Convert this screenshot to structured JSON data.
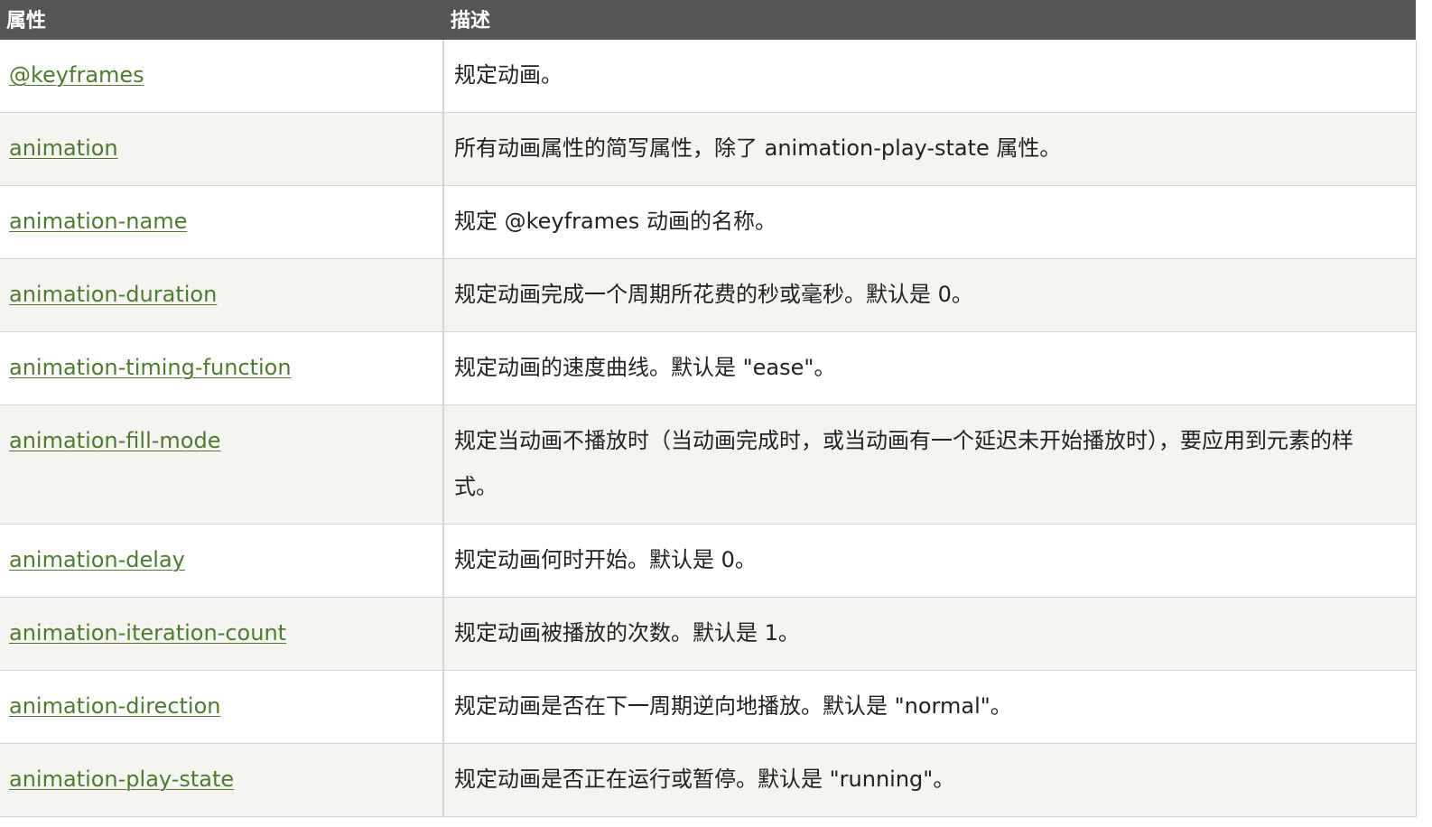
{
  "header": {
    "property": "属性",
    "description": "描述"
  },
  "rows": [
    {
      "property": "@keyframes",
      "description": "规定动画。"
    },
    {
      "property": "animation",
      "description": "所有动画属性的简写属性，除了 animation-play-state 属性。"
    },
    {
      "property": "animation-name",
      "description": "规定 @keyframes 动画的名称。"
    },
    {
      "property": "animation-duration",
      "description": "规定动画完成一个周期所花费的秒或毫秒。默认是 0。"
    },
    {
      "property": "animation-timing-function",
      "description": "规定动画的速度曲线。默认是 \"ease\"。"
    },
    {
      "property": "animation-fill-mode",
      "description": "规定当动画不播放时（当动画完成时，或当动画有一个延迟未开始播放时），要应用到元素的样式。"
    },
    {
      "property": "animation-delay",
      "description": "规定动画何时开始。默认是 0。"
    },
    {
      "property": "animation-iteration-count",
      "description": "规定动画被播放的次数。默认是 1。"
    },
    {
      "property": "animation-direction",
      "description": "规定动画是否在下一周期逆向地播放。默认是 \"normal\"。"
    },
    {
      "property": "animation-play-state",
      "description": "规定动画是否正在运行或暂停。默认是 \"running\"。"
    }
  ],
  "colors": {
    "header_bg": "#555555",
    "link": "#4f7a31",
    "alt_row": "#f5f4f0",
    "border": "#d4d4d4"
  }
}
